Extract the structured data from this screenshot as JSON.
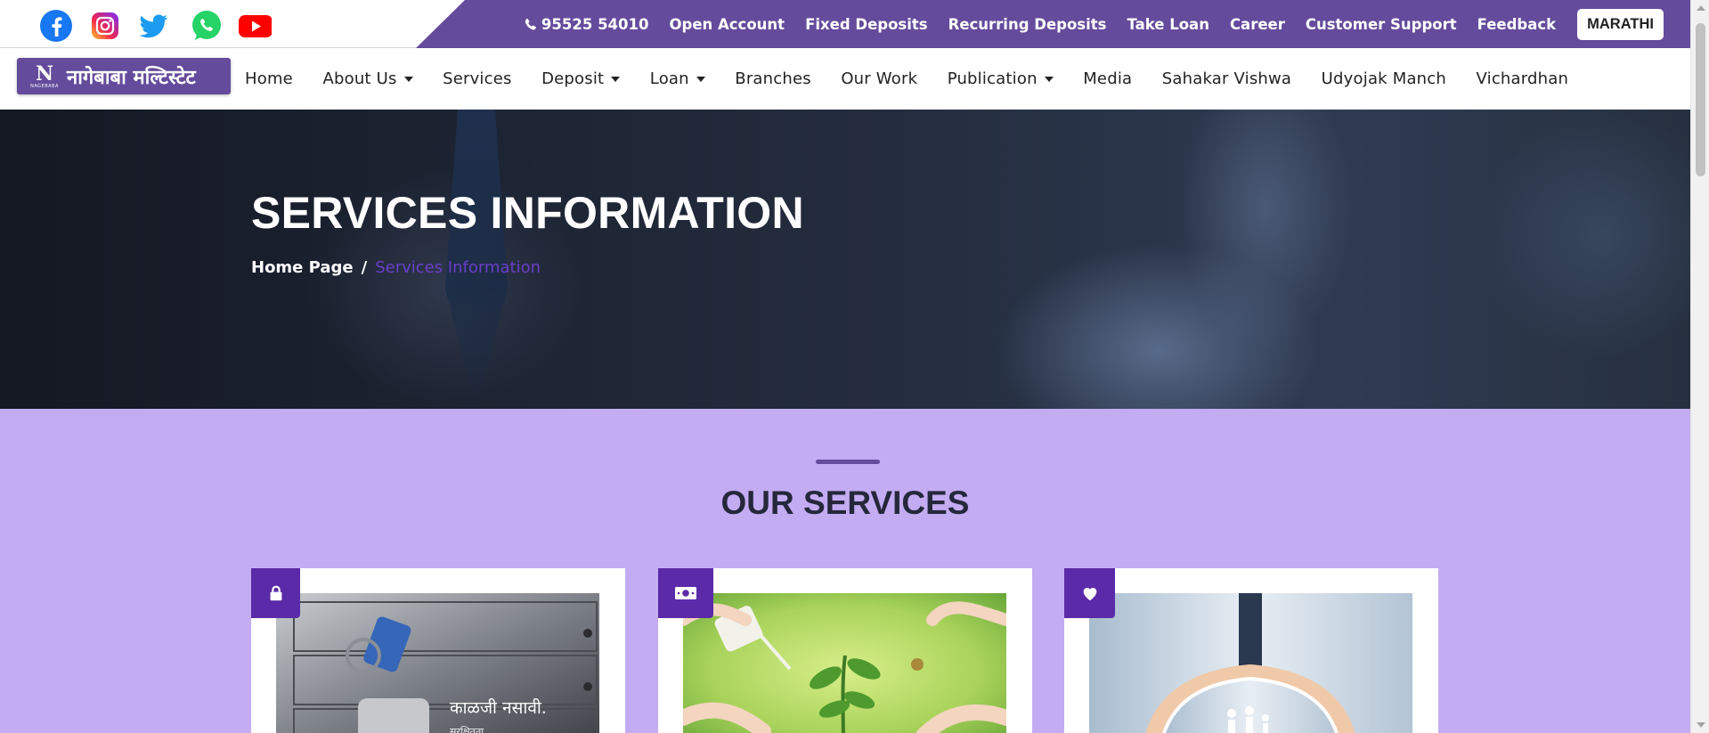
{
  "top_bar": {
    "phone": "95525 54010",
    "links": [
      "Open Account",
      "Fixed Deposits",
      "Recurring Deposits",
      "Take Loan",
      "Career",
      "Customer Support",
      "Feedback"
    ],
    "language_button": "MARATHI",
    "social_icons": [
      "facebook-icon",
      "instagram-icon",
      "twitter-icon",
      "whatsapp-icon",
      "youtube-icon"
    ],
    "accent_color": "#654b9c"
  },
  "logo": {
    "mark": "N",
    "mark_caption": "NAGEBABA",
    "text": "नागेबाबा मल्टिस्टेट"
  },
  "nav": {
    "items": [
      {
        "label": "Home",
        "dropdown": false
      },
      {
        "label": "About Us",
        "dropdown": true
      },
      {
        "label": "Services",
        "dropdown": false
      },
      {
        "label": "Deposit",
        "dropdown": true
      },
      {
        "label": "Loan",
        "dropdown": true
      },
      {
        "label": "Branches",
        "dropdown": false
      },
      {
        "label": "Our Work",
        "dropdown": false
      },
      {
        "label": "Publication",
        "dropdown": true
      },
      {
        "label": "Media",
        "dropdown": false
      },
      {
        "label": "Sahakar Vishwa",
        "dropdown": false
      },
      {
        "label": "Udyojak Manch",
        "dropdown": false
      },
      {
        "label": "Vichardhan",
        "dropdown": false
      }
    ]
  },
  "hero": {
    "title": "SERVICES INFORMATION",
    "breadcrumb": {
      "home": "Home Page",
      "separator": "/",
      "current": "Services Information"
    }
  },
  "services": {
    "title": "OUR SERVICES",
    "background_color": "#c4acf3",
    "cards": [
      {
        "icon": "lock-icon",
        "image_text": "काळजी नसावी.",
        "image_subtext": "सुरक्षितता"
      },
      {
        "icon": "money-icon",
        "image_text": "",
        "image_subtext": ""
      },
      {
        "icon": "heart-icon",
        "image_text": "",
        "image_subtext": ""
      }
    ]
  }
}
